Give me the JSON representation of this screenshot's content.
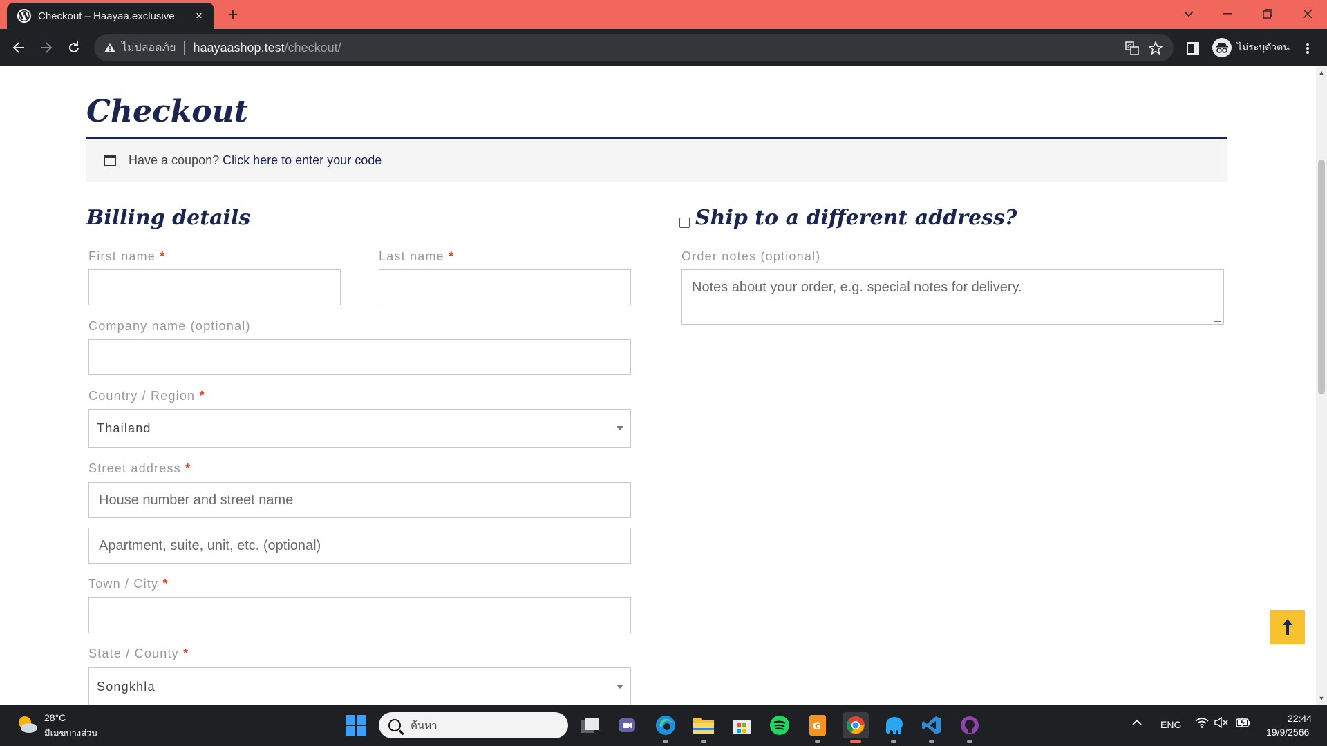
{
  "browser": {
    "tab_title": "Checkout – Haayaa.exclusive",
    "tab_close": "×",
    "new_tab": "+",
    "not_secure": "ไม่ปลอดภัย",
    "url_host": "haayaashop.test",
    "url_path": "/checkout/",
    "profile_label": "ไม่ระบุตัวตน"
  },
  "page": {
    "title": "Checkout",
    "coupon_text": "Have a coupon?",
    "coupon_link": "Click here to enter your code",
    "billing_title": "Billing details",
    "shipping_title": "Ship to a different address?",
    "required_mark": "*",
    "fields": {
      "first_name": {
        "label": "First name",
        "value": ""
      },
      "last_name": {
        "label": "Last name",
        "value": ""
      },
      "company": {
        "label": "Company name (optional)",
        "value": ""
      },
      "country": {
        "label": "Country / Region",
        "value": "Thailand"
      },
      "street": {
        "label": "Street address",
        "placeholder_1": "House number and street name",
        "placeholder_2": "Apartment, suite, unit, etc. (optional)"
      },
      "city": {
        "label": "Town / City",
        "value": ""
      },
      "state": {
        "label": "State / County",
        "value": "Songkhla"
      }
    },
    "order_notes": {
      "label": "Order notes (optional)",
      "placeholder": "Notes about your order, e.g. special notes for delivery."
    },
    "back_to_top": "🠕"
  },
  "taskbar": {
    "weather_temp": "28°C",
    "weather_desc": "มีเมฆบางส่วน",
    "search_placeholder": "ค้นหา",
    "language": "ENG",
    "time": "22:44",
    "date": "19/9/2566"
  },
  "colors": {
    "tabbar": "#f1675c",
    "chrome_dark": "#202124",
    "heading": "#1a2550",
    "required": "#e2401c",
    "back_to_top": "#f8c12f"
  }
}
